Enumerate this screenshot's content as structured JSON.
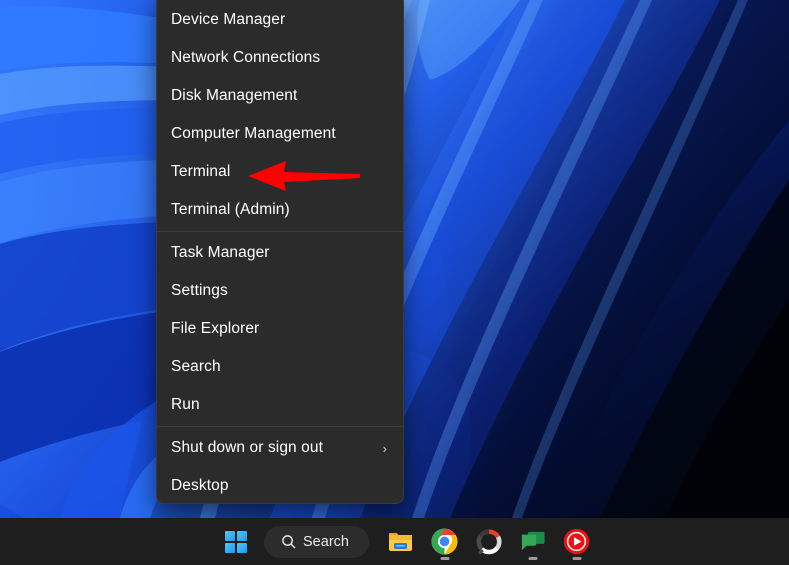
{
  "desktop": {
    "wallpaper_name": "windows-11-bloom-blue",
    "colors": {
      "deep": "#050d3d",
      "mid": "#1540c8",
      "bright": "#2f7bff",
      "highlight": "#63b2ff"
    }
  },
  "context_menu": {
    "name": "win-x-quick-link-menu",
    "groups": [
      {
        "items": [
          {
            "label": "Device Manager",
            "name": "menu-item-device-manager",
            "submenu": false
          },
          {
            "label": "Network Connections",
            "name": "menu-item-network-connections",
            "submenu": false
          },
          {
            "label": "Disk Management",
            "name": "menu-item-disk-management",
            "submenu": false
          },
          {
            "label": "Computer Management",
            "name": "menu-item-computer-management",
            "submenu": false
          },
          {
            "label": "Terminal",
            "name": "menu-item-terminal",
            "submenu": false
          },
          {
            "label": "Terminal (Admin)",
            "name": "menu-item-terminal-admin",
            "submenu": false
          }
        ]
      },
      {
        "items": [
          {
            "label": "Task Manager",
            "name": "menu-item-task-manager",
            "submenu": false
          },
          {
            "label": "Settings",
            "name": "menu-item-settings",
            "submenu": false
          },
          {
            "label": "File Explorer",
            "name": "menu-item-file-explorer",
            "submenu": false
          },
          {
            "label": "Search",
            "name": "menu-item-search",
            "submenu": false
          },
          {
            "label": "Run",
            "name": "menu-item-run",
            "submenu": false
          }
        ]
      },
      {
        "items": [
          {
            "label": "Shut down or sign out",
            "name": "menu-item-shut-down-or-sign-out",
            "submenu": true,
            "chevron": "›"
          },
          {
            "label": "Desktop",
            "name": "menu-item-desktop",
            "submenu": false
          }
        ]
      }
    ]
  },
  "annotation": {
    "type": "arrow",
    "name": "red-arrow-annotation",
    "color": "#ff0000",
    "points_to": "Terminal",
    "direction": "left"
  },
  "taskbar": {
    "start_button": {
      "name": "start-button",
      "icon": "windows-logo-icon"
    },
    "search": {
      "name": "taskbar-search-button",
      "label": "Search",
      "icon": "search-icon"
    },
    "buttons": [
      {
        "name": "taskbar-file-explorer",
        "icon": "file-explorer-icon",
        "running": false
      },
      {
        "name": "taskbar-google-chrome",
        "icon": "chrome-icon",
        "running": true
      },
      {
        "name": "taskbar-app-circle",
        "icon": "loading-circle-icon",
        "running": false
      },
      {
        "name": "taskbar-messages",
        "icon": "chat-bubbles-icon",
        "running": true
      },
      {
        "name": "taskbar-youtube",
        "icon": "youtube-play-icon",
        "running": true
      }
    ]
  }
}
